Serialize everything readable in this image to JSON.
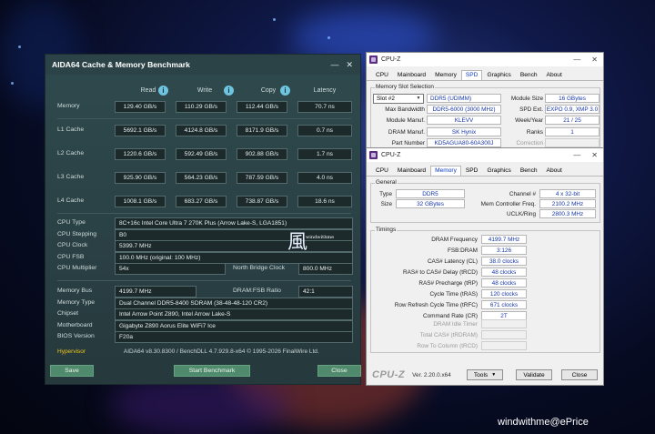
{
  "aida": {
    "title": "AIDA64 Cache & Memory Benchmark",
    "headers": {
      "read": "Read",
      "write": "Write",
      "copy": "Copy",
      "latency": "Latency"
    },
    "rows": [
      {
        "label": "Memory",
        "read": "129.40 GB/s",
        "write": "110.29 GB/s",
        "copy": "112.44 GB/s",
        "latency": "70.7 ns"
      },
      {
        "label": "L1 Cache",
        "read": "5692.1 GB/s",
        "write": "4124.8 GB/s",
        "copy": "8171.9 GB/s",
        "latency": "0.7 ns"
      },
      {
        "label": "L2 Cache",
        "read": "1220.6 GB/s",
        "write": "592.49 GB/s",
        "copy": "902.88 GB/s",
        "latency": "1.7 ns"
      },
      {
        "label": "L3 Cache",
        "read": "925.90 GB/s",
        "write": "564.23 GB/s",
        "copy": "787.59 GB/s",
        "latency": "4.0 ns"
      },
      {
        "label": "L4 Cache",
        "read": "1008.1 GB/s",
        "write": "683.27 GB/s",
        "copy": "738.87 GB/s",
        "latency": "18.6 ns"
      }
    ],
    "cpu_type_label": "CPU Type",
    "cpu_type": "8C+16c Intel Core Ultra 7 270K Plus  (Arrow Lake-S, LGA1851)",
    "cpu_stepping_label": "CPU Stepping",
    "cpu_stepping": "B0",
    "cpu_clock_label": "CPU Clock",
    "cpu_clock": "5399.7 MHz",
    "cpu_fsb_label": "CPU FSB",
    "cpu_fsb": "100.0 MHz  (original: 100 MHz)",
    "cpu_mult_label": "CPU Multiplier",
    "cpu_mult": "54x",
    "nb_clock_label": "North Bridge Clock",
    "nb_clock": "800.0 MHz",
    "mem_bus_label": "Memory Bus",
    "mem_bus": "4199.7 MHz",
    "dram_ratio_label": "DRAM:FSB Ratio",
    "dram_ratio": "42:1",
    "mem_type_label": "Memory Type",
    "mem_type": "Dual Channel DDR5-8400 SDRAM  (38-48-48-120 CR2)",
    "chipset_label": "Chipset",
    "chipset": "Intel Arrow Point Z890, Intel Arrow Lake-S",
    "mobo_label": "Motherboard",
    "mobo": "Gigabyte Z890 Aorus Elite WiFi7 Ice",
    "bios_label": "BIOS Version",
    "bios": "F20a",
    "hypervisor": "Hypervisor",
    "footer": "AIDA64 v8.30.8300 / BenchDLL 4.7.929.8-x64  © 1995-2026 FinalWire Ltd.",
    "save": "Save",
    "start": "Start Benchmark",
    "close": "Close"
  },
  "cpuz_spd": {
    "title": "CPU-Z",
    "tabs": [
      "CPU",
      "Mainboard",
      "Memory",
      "SPD",
      "Graphics",
      "Bench",
      "About"
    ],
    "active_tab": "SPD",
    "group": "Memory Slot Selection",
    "slot": "Slot #2",
    "type": "DDR5 (UDIMM)",
    "module_size_label": "Module Size",
    "module_size": "16 GBytes",
    "max_bw_label": "Max Bandwidth",
    "max_bw": "DDR5-6000 (3000 MHz)",
    "spd_ext_label": "SPD Ext.",
    "spd_ext": "EXPO 0.9, XMP 3.0",
    "manuf_label": "Module Manuf.",
    "manuf": "KLEVV",
    "week_label": "Week/Year",
    "week": "21 / 25",
    "dram_manuf_label": "DRAM Manuf.",
    "dram_manuf": "SK Hynix",
    "ranks_label": "Ranks",
    "ranks": "1",
    "part_label": "Part Number",
    "part": "KD5AGUA80-60A300J",
    "correction_label": "Correction"
  },
  "cpuz_mem": {
    "title": "CPU-Z",
    "tabs": [
      "CPU",
      "Mainboard",
      "Memory",
      "SPD",
      "Graphics",
      "Bench",
      "About"
    ],
    "active_tab": "Memory",
    "general": "General",
    "type_label": "Type",
    "type": "DDR5",
    "channel_label": "Channel #",
    "channel": "4 x 32-bit",
    "size_label": "Size",
    "size": "32 GBytes",
    "mcf_label": "Mem Controller Freq.",
    "mcf": "2100.2 MHz",
    "uclk_label": "UCLK/Ring",
    "uclk": "2800.3 MHz",
    "timings": "Timings",
    "timing_rows": [
      {
        "label": "DRAM Frequency",
        "value": "4199.7 MHz"
      },
      {
        "label": "FSB:DRAM",
        "value": "3:126"
      },
      {
        "label": "CAS# Latency (CL)",
        "value": "38.0 clocks"
      },
      {
        "label": "RAS# to CAS# Delay (tRCD)",
        "value": "48 clocks"
      },
      {
        "label": "RAS# Precharge (tRP)",
        "value": "48 clocks"
      },
      {
        "label": "Cycle Time (tRAS)",
        "value": "120 clocks"
      },
      {
        "label": "Row Refresh Cycle Time (tRFC)",
        "value": "671 clocks"
      },
      {
        "label": "Command Rate (CR)",
        "value": "2T"
      }
    ],
    "idle_label": "DRAM Idle Timer",
    "total_cas_label": "Total CAS# (tRDRAM)",
    "row_col_label": "Row To Column (tRCD)",
    "brand": "CPU-Z",
    "version": "Ver. 2.20.0.x64",
    "tools": "Tools",
    "validate": "Validate",
    "close": "Close"
  },
  "watermark": "windwithme@ePrice",
  "logo_text": "windwithme"
}
